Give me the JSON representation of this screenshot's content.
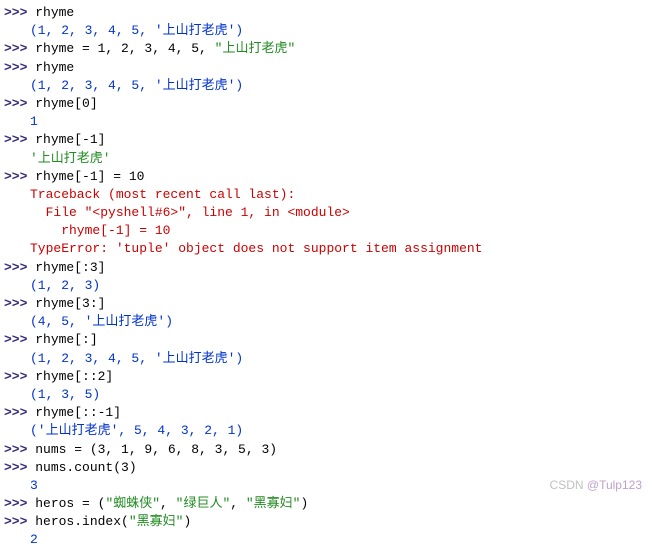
{
  "lines": [
    {
      "type": "in",
      "code": "rhyme"
    },
    {
      "type": "out-blue",
      "text": "(1, 2, 3, 4, 5, '上山打老虎')"
    },
    {
      "type": "in-mixed",
      "pre": "rhyme = 1, 2, 3, 4, 5, ",
      "str": "\"上山打老虎\""
    },
    {
      "type": "in",
      "code": "rhyme"
    },
    {
      "type": "out-blue",
      "text": "(1, 2, 3, 4, 5, '上山打老虎')"
    },
    {
      "type": "in",
      "code": "rhyme[0]"
    },
    {
      "type": "out-blue",
      "text": "1"
    },
    {
      "type": "in",
      "code": "rhyme[-1]"
    },
    {
      "type": "out-green",
      "text": "'上山打老虎'"
    },
    {
      "type": "in",
      "code": "rhyme[-1] = 10"
    },
    {
      "type": "err",
      "text": "Traceback (most recent call last):"
    },
    {
      "type": "err",
      "text": "  File \"<pyshell#6>\", line 1, in <module>"
    },
    {
      "type": "err",
      "text": "    rhyme[-1] = 10"
    },
    {
      "type": "err",
      "text": "TypeError: 'tuple' object does not support item assignment"
    },
    {
      "type": "in",
      "code": "rhyme[:3]"
    },
    {
      "type": "out-blue",
      "text": "(1, 2, 3)"
    },
    {
      "type": "in",
      "code": "rhyme[3:]"
    },
    {
      "type": "out-blue",
      "text": "(4, 5, '上山打老虎')"
    },
    {
      "type": "in",
      "code": "rhyme[:]"
    },
    {
      "type": "out-blue",
      "text": "(1, 2, 3, 4, 5, '上山打老虎')"
    },
    {
      "type": "in",
      "code": "rhyme[::2]"
    },
    {
      "type": "out-blue",
      "text": "(1, 3, 5)"
    },
    {
      "type": "in",
      "code": "rhyme[::-1]"
    },
    {
      "type": "out-blue",
      "text": "('上山打老虎', 5, 4, 3, 2, 1)"
    },
    {
      "type": "in",
      "code": "nums = (3, 1, 9, 6, 8, 3, 5, 3)"
    },
    {
      "type": "in",
      "code": "nums.count(3)"
    },
    {
      "type": "out-blue",
      "text": "3"
    },
    {
      "type": "in-mixed",
      "pre": "heros = (",
      "str": "\"蜘蛛侠\"",
      "mid": ", ",
      "str2": "\"绿巨人\"",
      "mid2": ", ",
      "str3": "\"黑寡妇\"",
      "post": ")"
    },
    {
      "type": "in-mixed",
      "pre": "heros.index(",
      "str": "\"黑寡妇\"",
      "post": ")"
    },
    {
      "type": "out-blue",
      "text": "2"
    }
  ],
  "prompt": ">>> ",
  "watermark": {
    "left": "CSDN ",
    "right": "@Tulp123"
  }
}
